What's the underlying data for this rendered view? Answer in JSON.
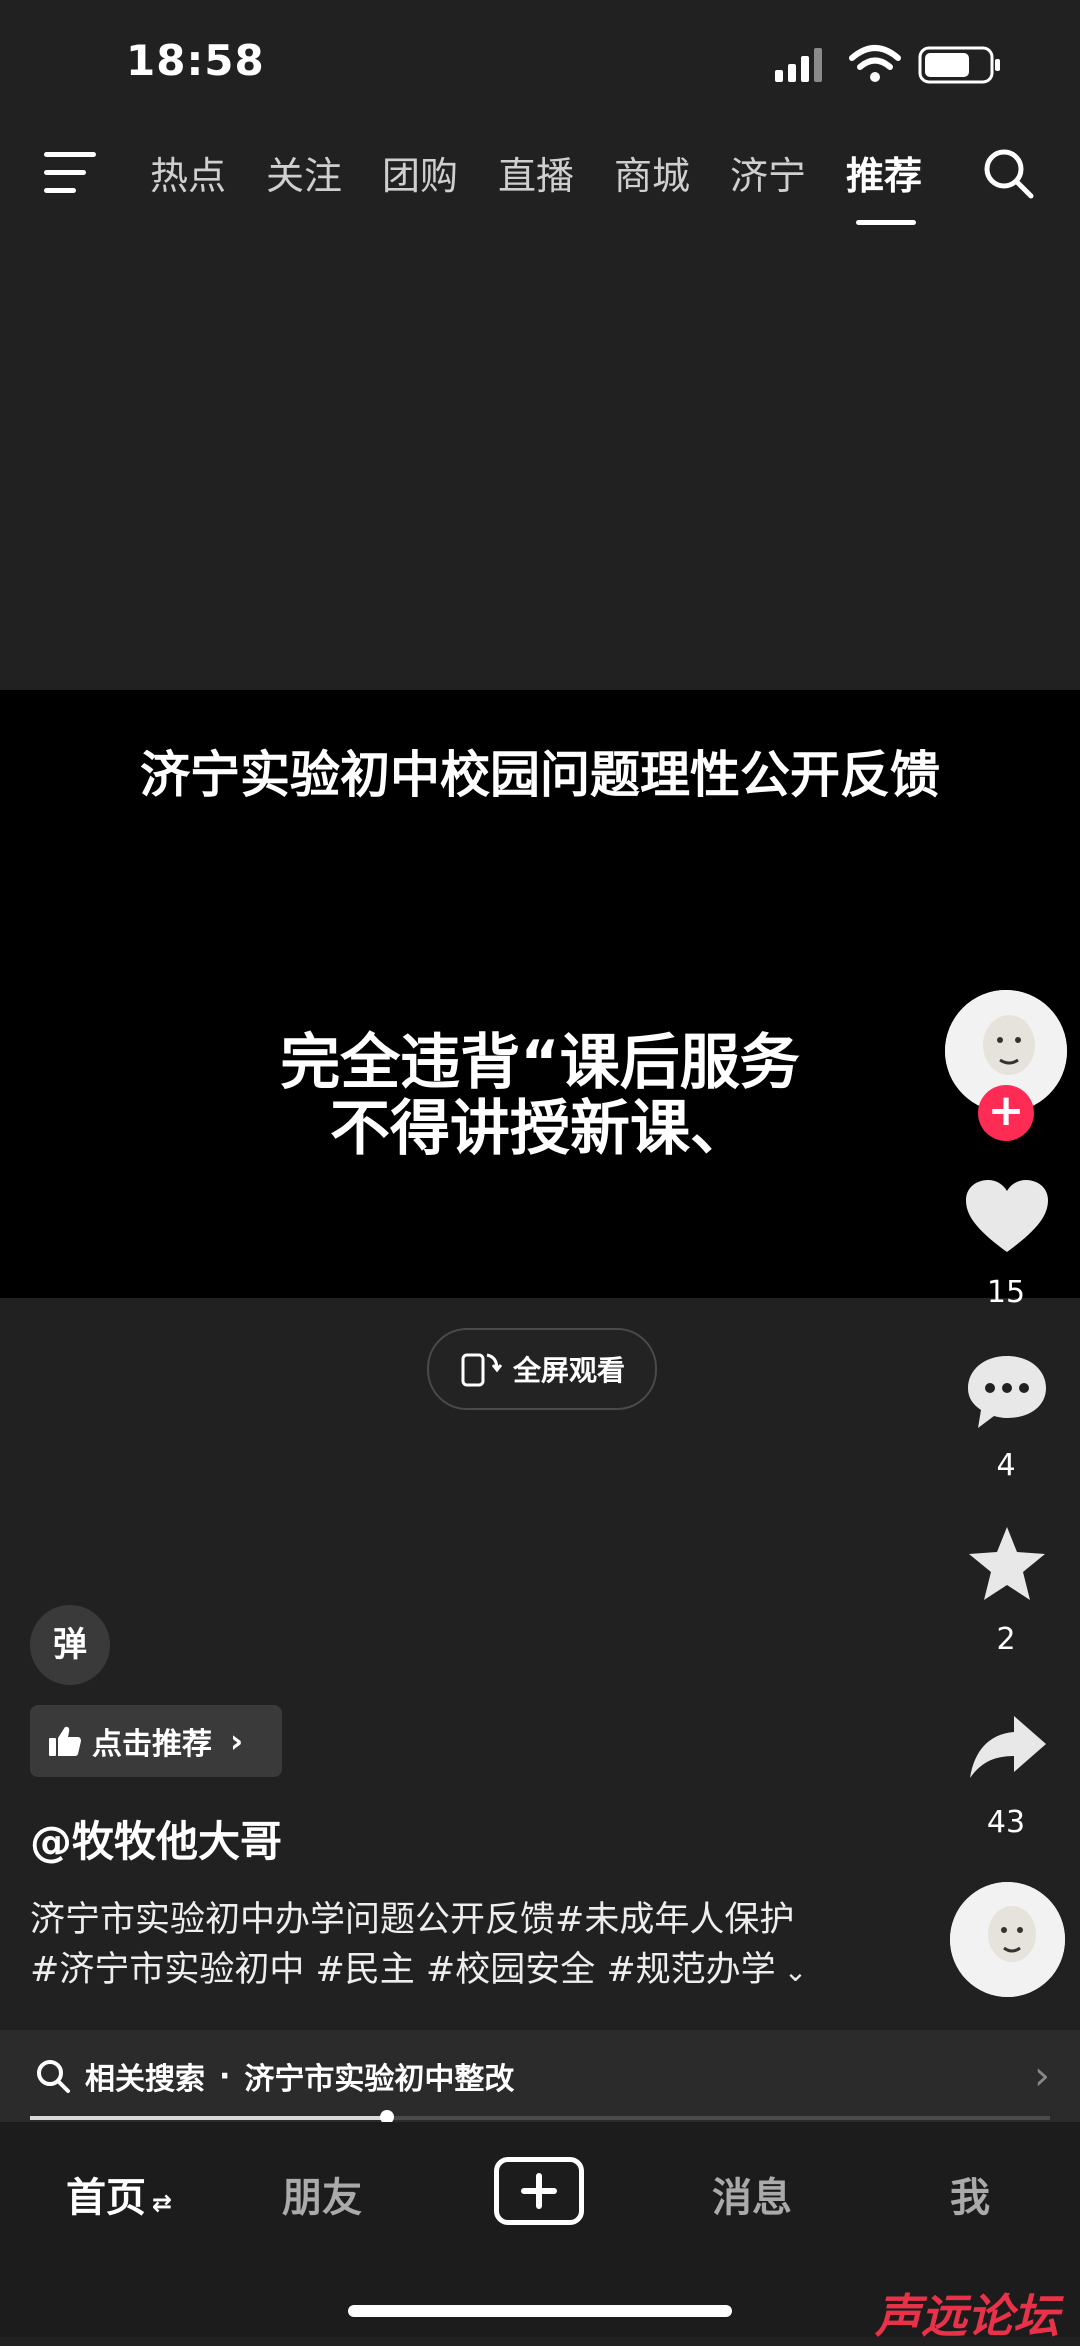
{
  "status_bar": {
    "time": "18:58"
  },
  "top_nav": {
    "tabs": [
      "热点",
      "关注",
      "团购",
      "直播",
      "商城",
      "济宁",
      "推荐"
    ],
    "active_tab": "推荐"
  },
  "video": {
    "title": "济宁实验初中校园问题理性公开反馈",
    "subtitle_line1": "完全违背“课后服务",
    "subtitle_line2": "不得讲授新课、",
    "fullscreen_label": "全屏观看"
  },
  "right_rail": {
    "likes": "15",
    "comments": "4",
    "favorites": "2",
    "shares": "43",
    "follow_symbol": "+"
  },
  "info": {
    "danmu_label": "弹",
    "recommend_label": "点击推荐",
    "author": "@牧牧他大哥",
    "caption_line1": "济宁市实验初中办学问题公开反馈#未成年人保护",
    "caption_line2": "#济宁市实验初中 #民主 #校园安全 #规范办学",
    "progress": 0.35
  },
  "related_search": {
    "label": "相关搜索",
    "separator": "·",
    "query": "济宁市实验初中整改"
  },
  "bottom_nav": {
    "home": "首页",
    "friends": "朋友",
    "messages": "消息",
    "me": "我"
  },
  "watermark": "声远论坛",
  "colors": {
    "accent": "#fe2c55",
    "background": "#212121"
  }
}
